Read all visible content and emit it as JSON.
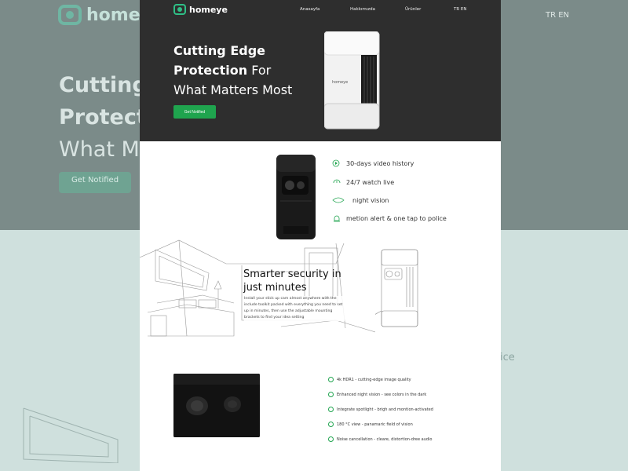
{
  "brand": {
    "name": "homeye",
    "accent": "#1fa44e",
    "logo_color": "#2fbf86",
    "icon": "homeye-logo-icon"
  },
  "nav": {
    "items": [
      "Anasayfa",
      "Hakkımızda",
      "Ürünler"
    ],
    "lang": "TR EN"
  },
  "hero": {
    "title_bold_1": "Cutting Edge",
    "title_bold_2": "Protection",
    "title_rest_2": " For",
    "title_line_3": "What Matters Most",
    "cta": "Get Notified",
    "device_label": "homeye"
  },
  "features": [
    {
      "icon": "play-icon",
      "label": "30-days video history"
    },
    {
      "icon": "24-7-icon",
      "label": "24/7 watch live"
    },
    {
      "icon": "eye-icon",
      "label": "night vision"
    },
    {
      "icon": "alert-icon",
      "label": "metion alert & one tap to police"
    }
  ],
  "smart": {
    "title": "Smarter security in just minutes",
    "body": "Install your stick up cam almost anywhere with the include toolkit packed with everything you need to set up in minutes, then use the adjustable mounting brackets to find your idea setting"
  },
  "specs": [
    "4k HDR1 - cutting-edge image quality",
    "Enhanced night vision - see colors in the dark",
    "Integrate spotlight - brigh and montion-activated",
    "180 °C view - panamaric field of vision",
    "Noise cancellation - cleare, distortion-dree audio"
  ],
  "background": {
    "title_1": "Cutting",
    "title_2": "Protecti",
    "title_3": "What Ma",
    "cta": "Get Notified",
    "side_text": "ice"
  }
}
